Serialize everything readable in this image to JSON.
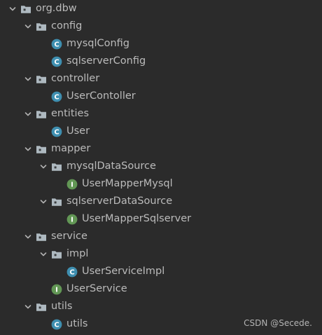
{
  "colors": {
    "background": "#2b2b2b",
    "text": "#bbbbbb",
    "arrow": "#b0b0b0",
    "folder_icon": "#aeb9c0",
    "class_badge": "#3f8fb0",
    "interface_badge": "#629755",
    "badge_letter": "#ffffff"
  },
  "tree": [
    {
      "label": "org.dbw",
      "kind": "package",
      "depth": 0,
      "expanded": true
    },
    {
      "label": "config",
      "kind": "package",
      "depth": 1,
      "expanded": true
    },
    {
      "label": "mysqlConfig",
      "kind": "class",
      "depth": 2
    },
    {
      "label": "sqlserverConfig",
      "kind": "class",
      "depth": 2
    },
    {
      "label": "controller",
      "kind": "package",
      "depth": 1,
      "expanded": true
    },
    {
      "label": "UserContoller",
      "kind": "class",
      "depth": 2
    },
    {
      "label": "entities",
      "kind": "package",
      "depth": 1,
      "expanded": true
    },
    {
      "label": "User",
      "kind": "class",
      "depth": 2
    },
    {
      "label": "mapper",
      "kind": "package",
      "depth": 1,
      "expanded": true
    },
    {
      "label": "mysqlDataSource",
      "kind": "package",
      "depth": 2,
      "expanded": true
    },
    {
      "label": "UserMapperMysql",
      "kind": "interface",
      "depth": 3
    },
    {
      "label": "sqlserverDataSource",
      "kind": "package",
      "depth": 2,
      "expanded": true
    },
    {
      "label": "UserMapperSqlserver",
      "kind": "interface",
      "depth": 3
    },
    {
      "label": "service",
      "kind": "package",
      "depth": 1,
      "expanded": true
    },
    {
      "label": "impl",
      "kind": "package",
      "depth": 2,
      "expanded": true
    },
    {
      "label": "UserServiceImpl",
      "kind": "class",
      "depth": 3
    },
    {
      "label": "UserService",
      "kind": "interface",
      "depth": 2
    },
    {
      "label": "utils",
      "kind": "package",
      "depth": 1,
      "expanded": true
    },
    {
      "label": "utils",
      "kind": "class",
      "depth": 2
    }
  ],
  "watermark": "CSDN @Secede."
}
